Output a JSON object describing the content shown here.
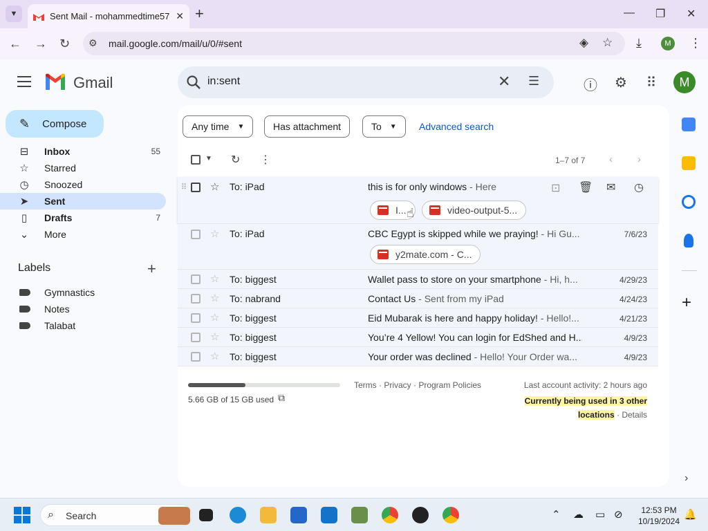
{
  "browser": {
    "tab_title": "Sent Mail - mohammedtime57",
    "url": "mail.google.com/mail/u/0/#sent",
    "profile_initial": "M"
  },
  "gmail": {
    "brand": "Gmail",
    "search_query": "in:sent",
    "avatar_initial": "M",
    "compose_label": "Compose",
    "nav": [
      {
        "icon": "inbox-icon",
        "label": "Inbox",
        "count": "55",
        "bold": true
      },
      {
        "icon": "star-icon",
        "label": "Starred",
        "count": ""
      },
      {
        "icon": "clock-icon",
        "label": "Snoozed",
        "count": ""
      },
      {
        "icon": "send-icon",
        "label": "Sent",
        "count": "",
        "bold": true,
        "active": true
      },
      {
        "icon": "draft-icon",
        "label": "Drafts",
        "count": "7",
        "bold": true
      },
      {
        "icon": "chevron-down-icon",
        "label": "More",
        "count": ""
      }
    ],
    "labels_title": "Labels",
    "labels": [
      "Gymnastics",
      "Notes",
      "Talabat"
    ],
    "filters": {
      "any_time": "Any time",
      "has_attachment": "Has attachment",
      "to": "To",
      "advanced": "Advanced search"
    },
    "pager": "1–7 of 7",
    "messages": [
      {
        "to": "To: iPad",
        "subject": "this is for only windows",
        "snippet": " - Here",
        "date": "",
        "attachments": [
          "I...",
          "video-output-5..."
        ]
      },
      {
        "to": "To: iPad",
        "subject": "CBC Egypt is skipped while we praying!",
        "snippet": " - Hi Gu...",
        "date": "7/6/23",
        "attachments": [
          "y2mate.com - C..."
        ]
      },
      {
        "to": "To: biggest",
        "subject": "Wallet pass to store on your smartphone",
        "snippet": " - Hi, h...",
        "date": "4/29/23"
      },
      {
        "to": "To: nabrand",
        "subject": "Contact Us",
        "snippet": " - Sent from my iPad",
        "date": "4/24/23"
      },
      {
        "to": "To: biggest",
        "subject": "Eid Mubarak is here and happy holiday!",
        "snippet": " - Hello!...",
        "date": "4/21/23"
      },
      {
        "to": "To: biggest",
        "subject": "You’re 4 Yellow! You can login for EdShed and H...",
        "snippet": "",
        "date": "4/9/23"
      },
      {
        "to": "To: biggest",
        "subject": "Your order was declined",
        "snippet": " - Hello! Your Order wa...",
        "date": "4/9/23"
      }
    ],
    "footer": {
      "storage_used": "5.66 GB of 15 GB used",
      "storage_fraction": 0.377,
      "links": "Terms · Privacy · Program Policies",
      "last_activity": "Last account activity: 2 hours ago",
      "used_in_1": "Currently being used in 3 other",
      "used_in_2": "locations",
      "details": " · Details"
    }
  },
  "taskbar": {
    "search_label": "Search",
    "time": "12:53 PM",
    "date": "10/19/2024"
  },
  "colors": {
    "accent": "#0b57d0",
    "compose_bg": "#c2e7ff",
    "active_nav": "#d3e3fd"
  }
}
